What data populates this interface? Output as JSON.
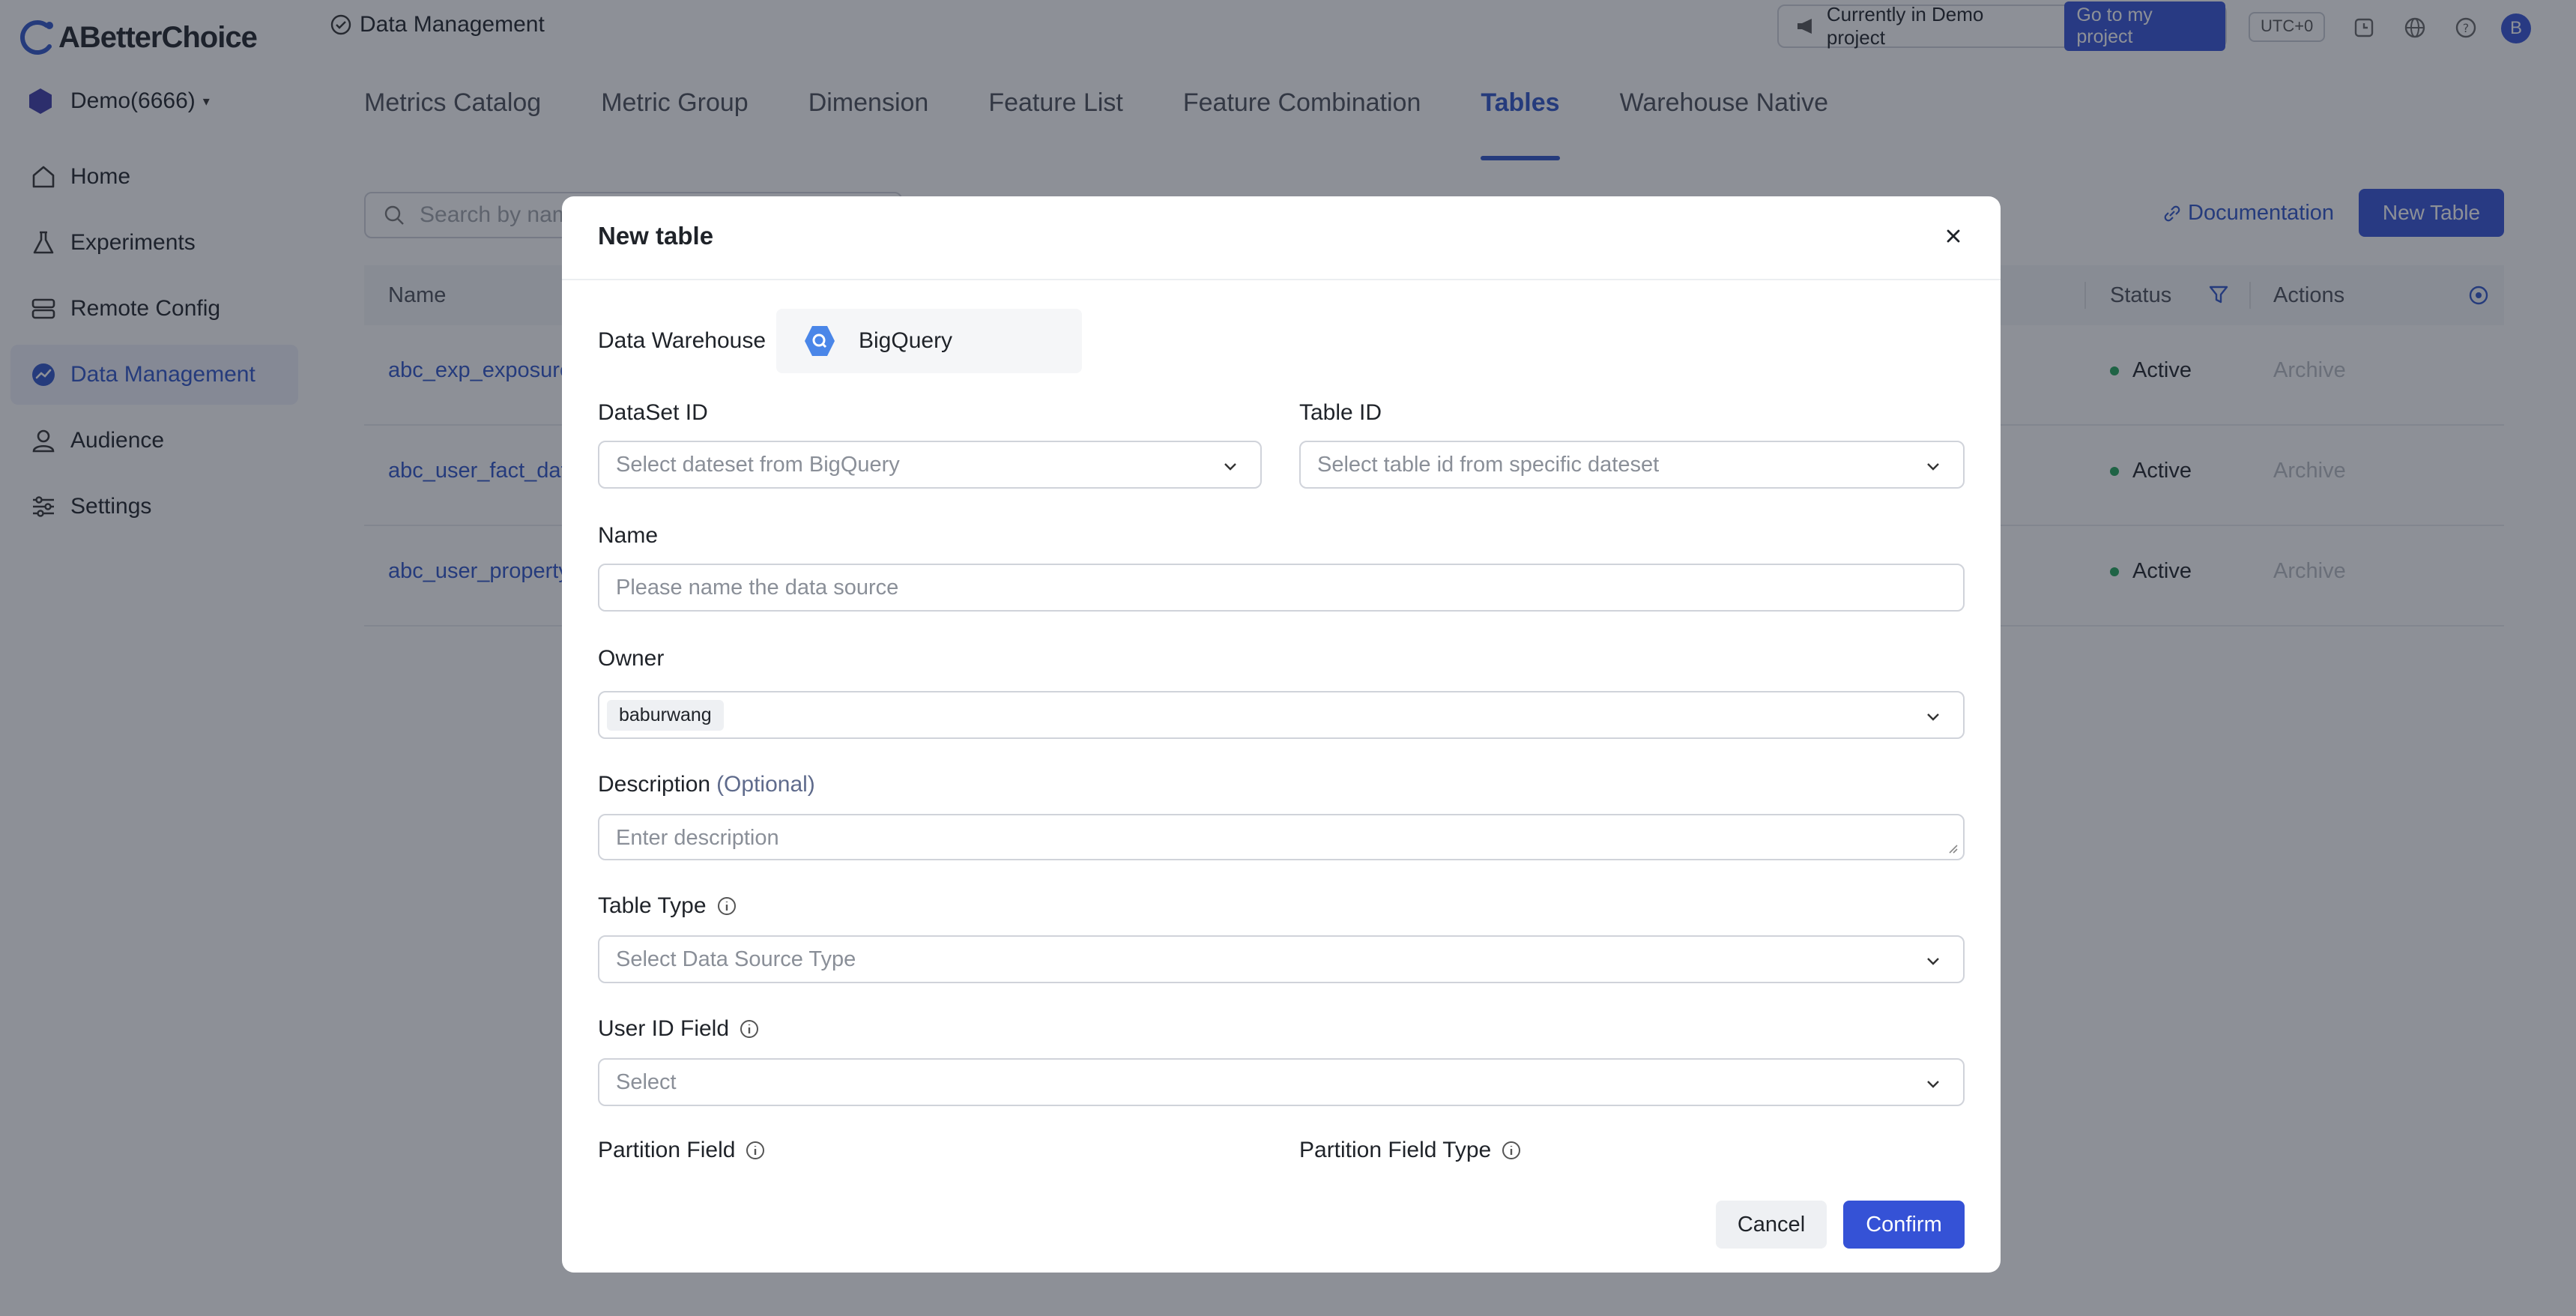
{
  "brand": {
    "name": "ABetterChoice"
  },
  "project": {
    "name": "Demo(6666)"
  },
  "sidebar": {
    "items": [
      {
        "label": "Home",
        "icon": "home-icon"
      },
      {
        "label": "Experiments",
        "icon": "flask-icon"
      },
      {
        "label": "Remote Config",
        "icon": "server-icon"
      },
      {
        "label": "Data Management",
        "icon": "chart-icon",
        "active": true
      },
      {
        "label": "Audience",
        "icon": "user-icon"
      },
      {
        "label": "Settings",
        "icon": "sliders-icon"
      }
    ]
  },
  "topbar": {
    "breadcrumb": "Data Management",
    "demo_notice": "Currently in Demo project",
    "goto_label": "Go to my project",
    "timezone": "UTC+0",
    "avatar_initial": "B"
  },
  "tabs": [
    "Metrics Catalog",
    "Metric Group",
    "Dimension",
    "Feature List",
    "Feature Combination",
    "Tables",
    "Warehouse Native"
  ],
  "active_tab": "Tables",
  "search": {
    "placeholder": "Search by name"
  },
  "documentation_label": "Documentation",
  "new_table_label": "New Table",
  "table": {
    "headers": {
      "name": "Name",
      "status": "Status",
      "actions": "Actions"
    },
    "rows": [
      {
        "name": "abc_exp_exposure",
        "status": "Active",
        "action": "Archive"
      },
      {
        "name": "abc_user_fact_data",
        "status": "Active",
        "action": "Archive"
      },
      {
        "name": "abc_user_property",
        "status": "Active",
        "action": "Archive"
      }
    ]
  },
  "modal": {
    "title": "New table",
    "data_warehouse_label": "Data Warehouse",
    "data_warehouse_value": "BigQuery",
    "dataset_label": "DataSet ID",
    "dataset_placeholder": "Select dateset from BigQuery",
    "tableid_label": "Table ID",
    "tableid_placeholder": "Select table id from specific dateset",
    "name_label": "Name",
    "name_placeholder": "Please name the data source",
    "owner_label": "Owner",
    "owner_value": "baburwang",
    "description_label": "Description",
    "description_optional": "(Optional)",
    "description_placeholder": "Enter description",
    "table_type_label": "Table Type",
    "table_type_placeholder": "Select Data Source Type",
    "user_id_label": "User ID Field",
    "user_id_placeholder": "Select",
    "partition_field_label": "Partition Field",
    "partition_type_label": "Partition Field Type",
    "cancel_label": "Cancel",
    "confirm_label": "Confirm"
  },
  "colors": {
    "accent": "#3552d6",
    "link": "#2f54c8",
    "active_dot": "#23a55a"
  }
}
